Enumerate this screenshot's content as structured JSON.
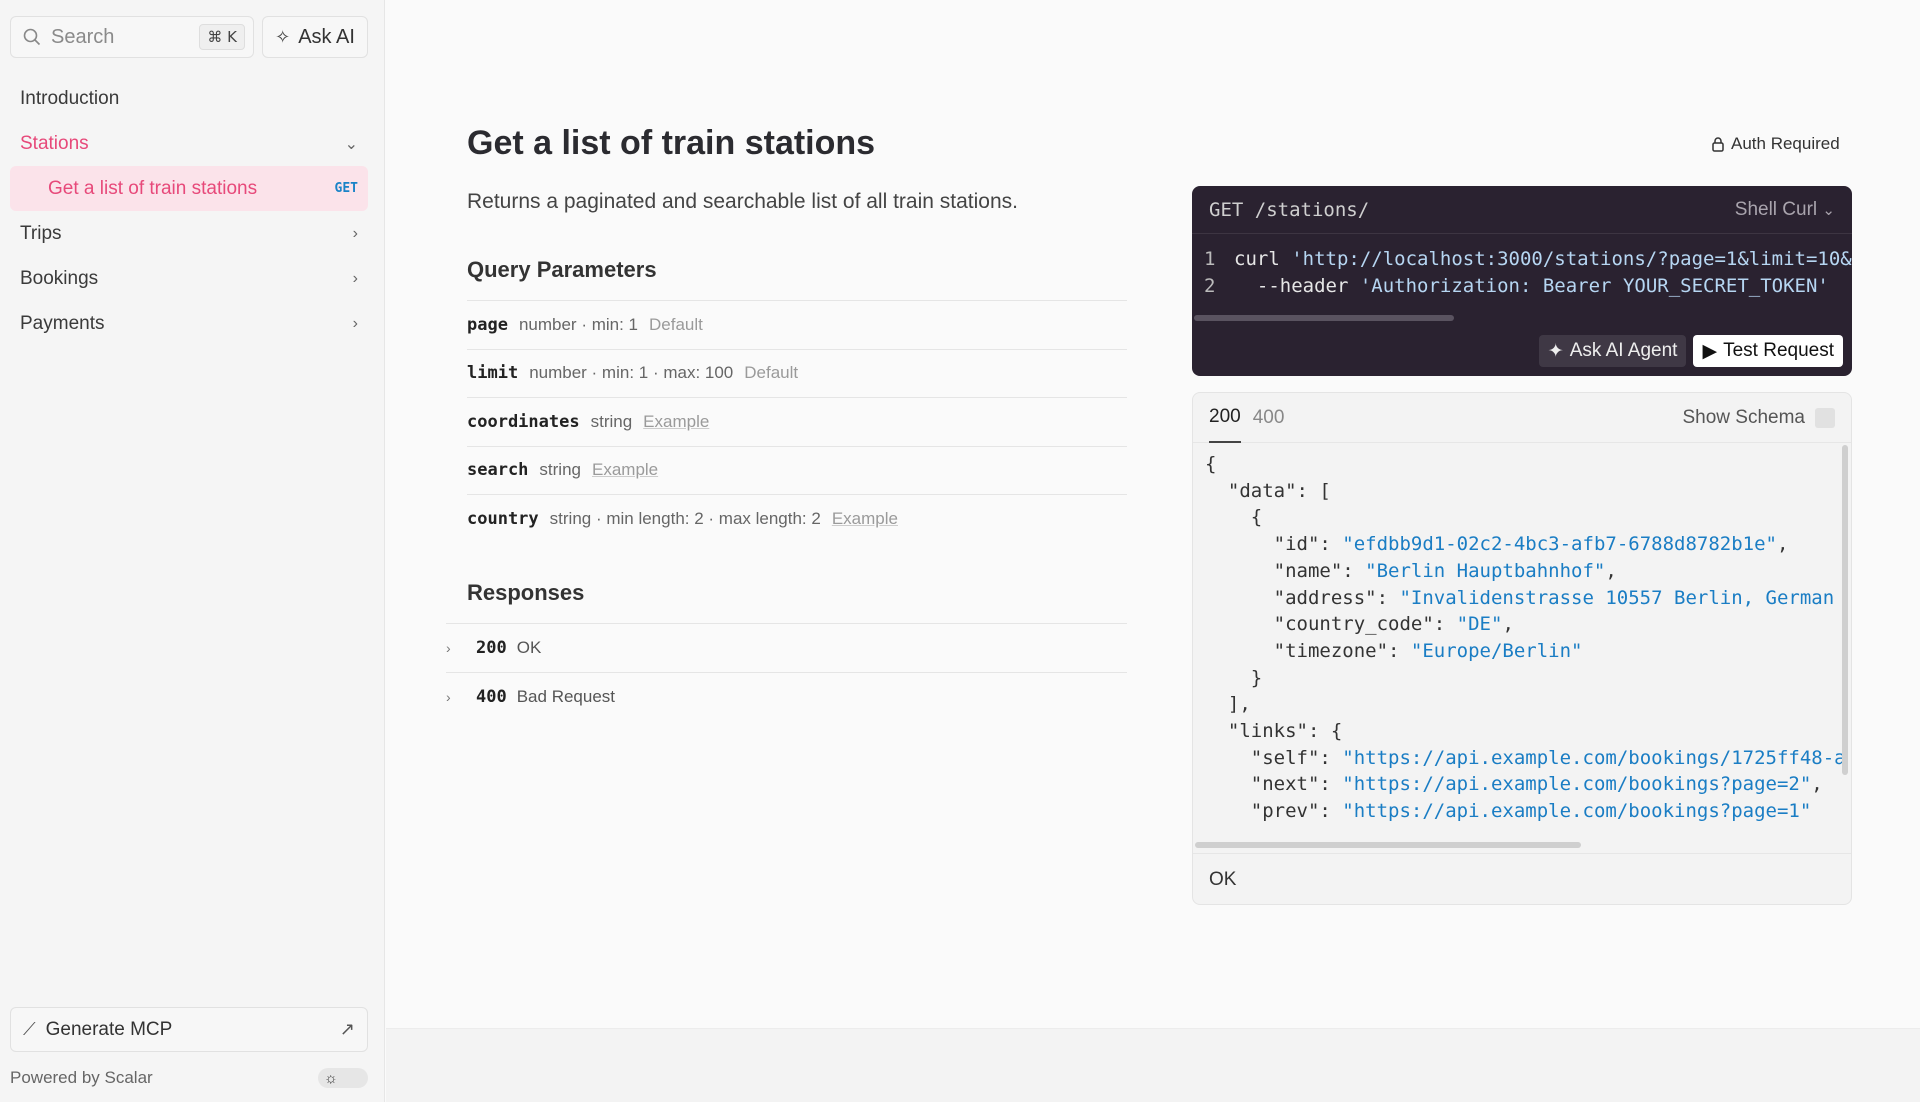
{
  "sidebar": {
    "search_placeholder": "Search",
    "search_shortcut": "⌘ K",
    "ask_ai_label": "Ask AI",
    "items": [
      {
        "label": "Introduction"
      },
      {
        "label": "Stations",
        "active": true
      },
      {
        "label": "Get a list of train stations",
        "method": "GET"
      },
      {
        "label": "Trips"
      },
      {
        "label": "Bookings"
      },
      {
        "label": "Payments"
      }
    ],
    "generate_mcp_label": "Generate MCP",
    "powered_by": "Powered by Scalar"
  },
  "endpoint": {
    "title": "Get a list of train stations",
    "description": "Returns a paginated and searchable list of all train stations.",
    "auth_label": "Auth Required",
    "query_heading": "Query Parameters",
    "params": [
      {
        "name": "page",
        "meta": "number · min:  1",
        "extra": "Default"
      },
      {
        "name": "limit",
        "meta": "number · min:  1 · max:  100",
        "extra": "Default"
      },
      {
        "name": "coordinates",
        "meta": "string",
        "extra": "Example"
      },
      {
        "name": "search",
        "meta": "string",
        "extra": "Example"
      },
      {
        "name": "country",
        "meta": "string · min length:  2 · max length:  2",
        "extra": "Example"
      }
    ],
    "responses_heading": "Responses",
    "responses": [
      {
        "code": "200",
        "text": "OK"
      },
      {
        "code": "400",
        "text": "Bad Request"
      }
    ]
  },
  "request": {
    "method_path": "GET /stations/",
    "language": "Shell Curl",
    "line1_num": "1",
    "line1_cmd": "curl ",
    "line1_url": "'http://localhost:3000/stations/?page=1&limit=10&",
    "line2_num": "2",
    "line2_cmd": "  --header ",
    "line2_val": "'Authorization: Bearer YOUR_SECRET_TOKEN'",
    "ask_agent_label": "Ask AI Agent",
    "test_request_label": "Test Request"
  },
  "response": {
    "tabs": [
      "200",
      "400"
    ],
    "show_schema_label": "Show Schema",
    "status_text": "OK",
    "json": {
      "id": "\"efdbb9d1-02c2-4bc3-afb7-6788d8782b1e\"",
      "name": "\"Berlin Hauptbahnhof\"",
      "address": "\"Invalidenstrasse 10557 Berlin, German",
      "country_code": "\"DE\"",
      "timezone": "\"Europe/Berlin\"",
      "self": "\"https://api.example.com/bookings/1725ff48-a",
      "next": "\"https://api.example.com/bookings?page=2\"",
      "prev": "\"https://api.example.com/bookings?page=1\""
    }
  }
}
